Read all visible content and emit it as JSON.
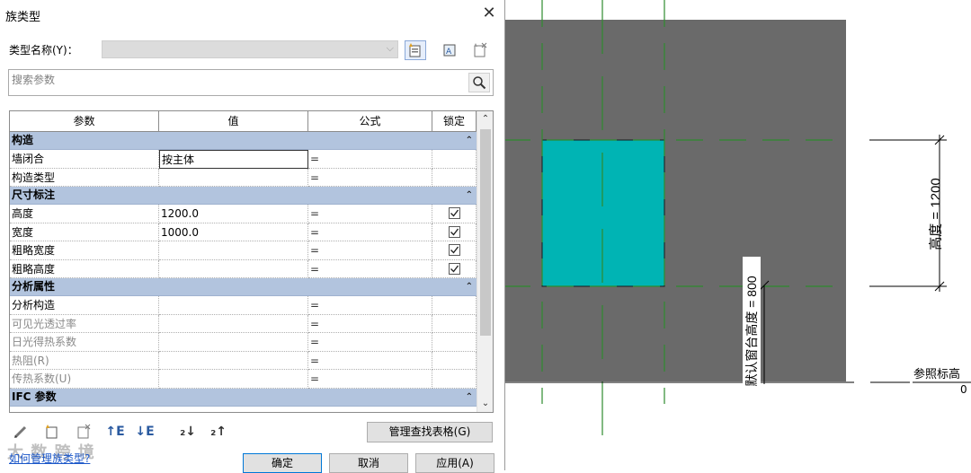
{
  "dialog": {
    "title": "族类型",
    "type_name_label": "类型名称(Y)：",
    "type_name_value": "",
    "search_placeholder": "搜索参数",
    "columns": [
      "参数",
      "值",
      "公式",
      "锁定"
    ],
    "groups": [
      {
        "name": "构造",
        "rows": [
          {
            "param": "墙闭合",
            "value": "按主体",
            "formula": "=",
            "locked": null,
            "dim": false,
            "editing": true
          },
          {
            "param": "构造类型",
            "value": "",
            "formula": "=",
            "locked": null,
            "dim": false,
            "editing": false
          }
        ]
      },
      {
        "name": "尺寸标注",
        "rows": [
          {
            "param": "高度",
            "value": "1200.0",
            "formula": "=",
            "locked": true,
            "dim": false,
            "editing": false
          },
          {
            "param": "宽度",
            "value": "1000.0",
            "formula": "=",
            "locked": true,
            "dim": false,
            "editing": false
          },
          {
            "param": "粗略宽度",
            "value": "",
            "formula": "=",
            "locked": true,
            "dim": false,
            "editing": false
          },
          {
            "param": "粗略高度",
            "value": "",
            "formula": "=",
            "locked": true,
            "dim": false,
            "editing": false
          }
        ]
      },
      {
        "name": "分析属性",
        "rows": [
          {
            "param": "分析构造",
            "value": "",
            "formula": "=",
            "locked": null,
            "dim": false,
            "editing": false
          },
          {
            "param": "可见光透过率",
            "value": "",
            "formula": "=",
            "locked": null,
            "dim": true,
            "editing": false
          },
          {
            "param": "日光得热系数",
            "value": "",
            "formula": "=",
            "locked": null,
            "dim": true,
            "editing": false
          },
          {
            "param": "热阻(R)",
            "value": "",
            "formula": "=",
            "locked": null,
            "dim": true,
            "editing": false
          },
          {
            "param": "传热系数(U)",
            "value": "",
            "formula": "=",
            "locked": null,
            "dim": true,
            "editing": false
          }
        ]
      },
      {
        "name": "IFC 参数",
        "rows": []
      }
    ],
    "lookup_button": "管理查找表格(G)",
    "howto_link": "如何管理族类型?",
    "watermark": "大 数 跨 境",
    "ok_button": "确定",
    "cancel_button": "取消",
    "apply_button": "应用(A)",
    "close_glyph": "✕",
    "collapse_glyph": "⌃",
    "icons": [
      "new-type-icon",
      "rename-type-icon",
      "delete-type-icon",
      "search-icon",
      "edit-pencil-icon",
      "new-param-icon",
      "delete-param-icon",
      "move-up-icon",
      "move-down-icon",
      "sort-asc-icon",
      "sort-desc-icon"
    ]
  },
  "view": {
    "height_dim_label": "高度 = 1200",
    "sill_dim_label": "默认窗台高度 = 800",
    "level_label": "参照标高",
    "level_value": "0",
    "colors": {
      "wall": "#6a6a6a",
      "glass": "#00b4b4",
      "ref_plane": "#2e8b2e",
      "dim": "#000000"
    }
  }
}
